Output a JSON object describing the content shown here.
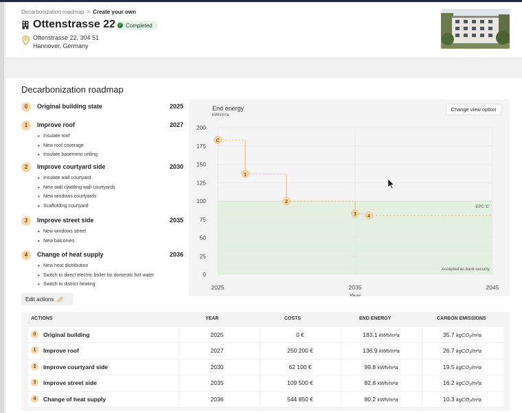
{
  "breadcrumb": {
    "parent": "Decarbonization roadmap",
    "separator": ">",
    "current": "Create your own"
  },
  "header": {
    "title": "Ottenstrasse 22",
    "status": "Completed",
    "address_line1": "Ottenstrasse 22, 304 51",
    "address_line2": "Hannover, Germany"
  },
  "roadmap": {
    "title": "Decarbonization roadmap",
    "steps": [
      {
        "num": "0",
        "label": "Original building state",
        "year": "2025",
        "items": []
      },
      {
        "num": "1",
        "label": "Improve roof",
        "year": "2027",
        "items": [
          "Insulate roof",
          "New roof coverage",
          "Insulate basement ceiling"
        ]
      },
      {
        "num": "2",
        "label": "Improve courtyard side",
        "year": "2030",
        "items": [
          "Insulate wall courtyard",
          "New wall cladding wall courtyards",
          "New windows courtyards",
          "Scaffolding courtyard"
        ]
      },
      {
        "num": "3",
        "label": "Improve street side",
        "year": "2035",
        "items": [
          "New windows street",
          "New balconies"
        ]
      },
      {
        "num": "4",
        "label": "Change of heat supply",
        "year": "2036",
        "items": [
          "New heat distribution",
          "Switch to direct electric boiler for domestic hot water",
          "Switch to district heating"
        ]
      }
    ],
    "edit_label": "Edit actions"
  },
  "chart": {
    "title": "End energy",
    "unit": "kWh/m²a",
    "view_button": "Change view option",
    "epc_label": "EPC 'C'",
    "bank_label": "Accepted as bank security",
    "xlabel": "Year"
  },
  "chart_data": {
    "type": "line",
    "title": "End energy",
    "ylabel": "kWh/m²a",
    "xlabel": "Year",
    "xlim": [
      2025,
      2045
    ],
    "ylim": [
      0,
      200
    ],
    "xticks": [
      2025,
      2035,
      2045
    ],
    "yticks": [
      0,
      25,
      50,
      75,
      100,
      125,
      150,
      175,
      200
    ],
    "grid": true,
    "points": [
      {
        "label": "C",
        "x": 2025,
        "y": 183.1
      },
      {
        "label": "1",
        "x": 2027,
        "y": 136.9
      },
      {
        "label": "2",
        "x": 2030,
        "y": 99.8
      },
      {
        "label": "3",
        "x": 2035,
        "y": 82.8
      },
      {
        "label": "4",
        "x": 2036,
        "y": 80.2
      }
    ],
    "threshold_band": {
      "label": "EPC 'C'",
      "y_max": 100,
      "note": "Accepted as bank security"
    },
    "colors": {
      "step_line": "#f4b26a",
      "marker_fill": "#fbd7a8",
      "band": "#e3f0df"
    }
  },
  "table": {
    "headers": [
      "ACTIONS",
      "YEAR",
      "COSTS",
      "END ENERGY",
      "CARBON EMISSIONS"
    ],
    "rows": [
      {
        "num": "0",
        "action": "Original building",
        "year": "2025",
        "cost": "0 €",
        "energy": "183.1",
        "emissions": "35.7"
      },
      {
        "num": "1",
        "action": "Improve roof",
        "year": "2027",
        "cost": "250 200 €",
        "energy": "136.9",
        "emissions": "26.7"
      },
      {
        "num": "2",
        "action": "Improve courtyard side",
        "year": "2030",
        "cost": "62 100 €",
        "energy": "99.8",
        "emissions": "19.5"
      },
      {
        "num": "3",
        "action": "Improve street side",
        "year": "2035",
        "cost": "109 500 €",
        "energy": "82.8",
        "emissions": "16.2"
      },
      {
        "num": "4",
        "action": "Change of heat supply",
        "year": "2036",
        "cost": "544 850 €",
        "energy": "80.2",
        "emissions": "10.3"
      }
    ],
    "energy_unit": "kWh/m²a",
    "emissions_unit": "kgCO₂/m²a"
  }
}
